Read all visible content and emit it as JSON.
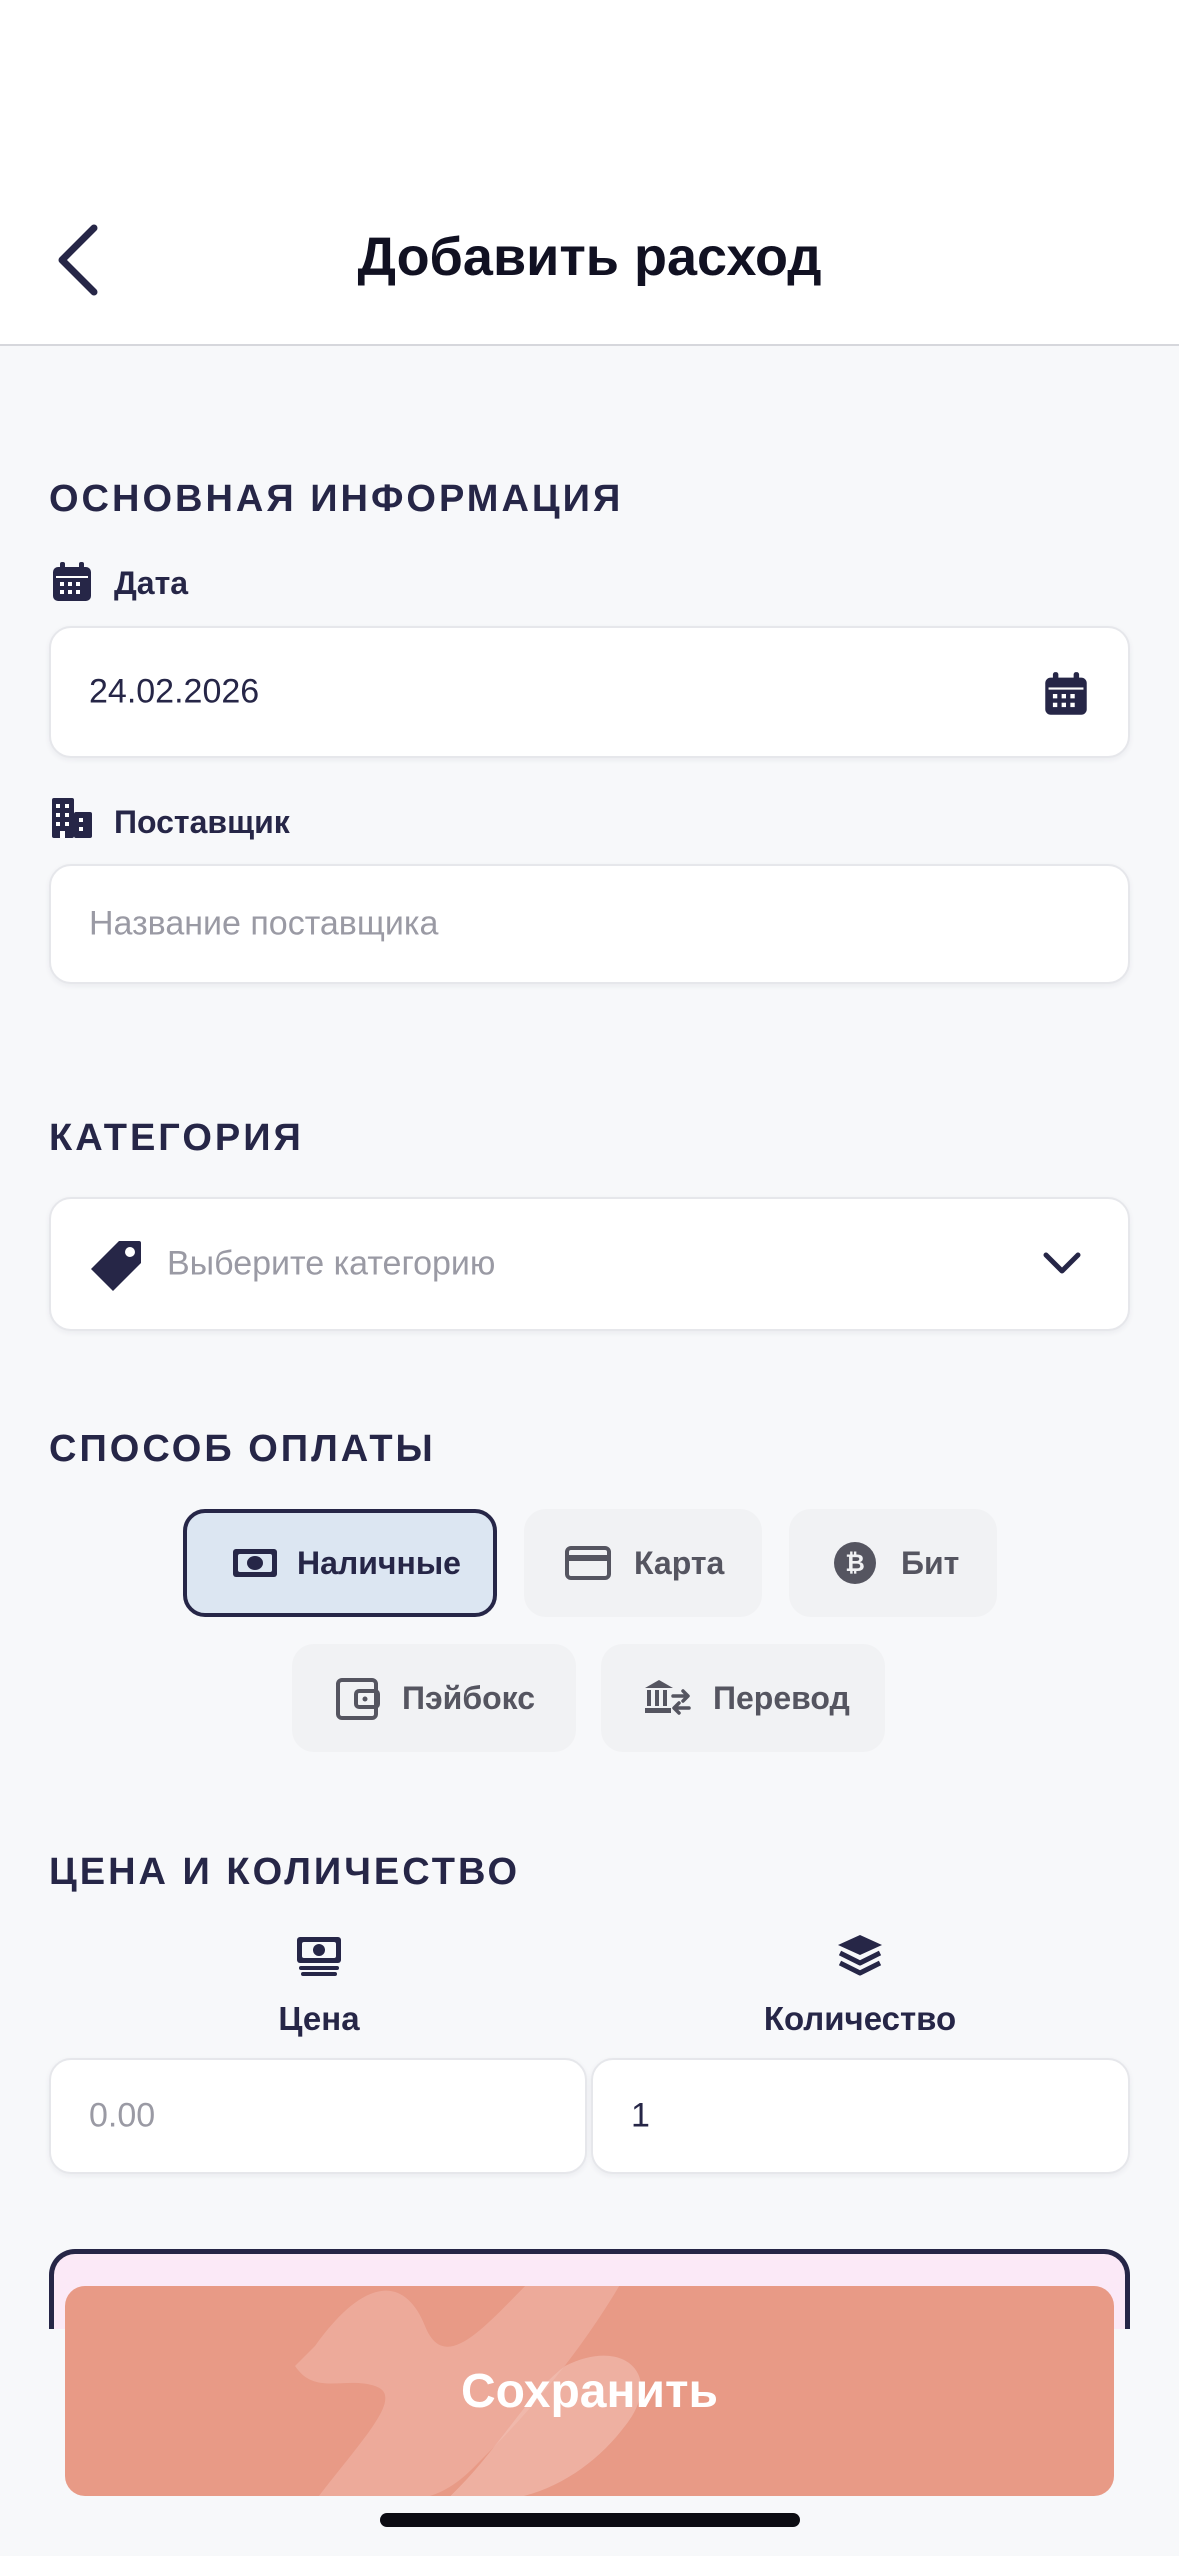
{
  "header": {
    "title": "Добавить расход"
  },
  "basic_info": {
    "section_title": "ОСНОВНАЯ ИНФОРМАЦИЯ",
    "date_label": "Дата",
    "date_value": "24.02.2026",
    "supplier_label": "Поставщик",
    "supplier_placeholder": "Название поставщика"
  },
  "category": {
    "section_title": "КАТЕГОРИЯ",
    "placeholder": "Выберите категорию"
  },
  "payment": {
    "section_title": "СПОСОБ ОПЛАТЫ",
    "options": [
      {
        "label": "Наличные",
        "icon": "cash-icon",
        "selected": true
      },
      {
        "label": "Карта",
        "icon": "credit-card-icon",
        "selected": false
      },
      {
        "label": "Бит",
        "icon": "bit-coin-icon",
        "selected": false
      },
      {
        "label": "Пэйбокс",
        "icon": "wallet-icon",
        "selected": false
      },
      {
        "label": "Перевод",
        "icon": "bank-transfer-icon",
        "selected": false
      }
    ]
  },
  "price_qty": {
    "section_title": "ЦЕНА И КОЛИЧЕСТВО",
    "price_label": "Цена",
    "price_placeholder": "0.00",
    "quantity_label": "Количество",
    "quantity_value": "1"
  },
  "actions": {
    "save_label": "Сохранить"
  },
  "colors": {
    "primary": "#262647",
    "selected_chip_bg": "#dce6f2",
    "save_button": "#e89a86",
    "background": "#f7f8fa"
  }
}
